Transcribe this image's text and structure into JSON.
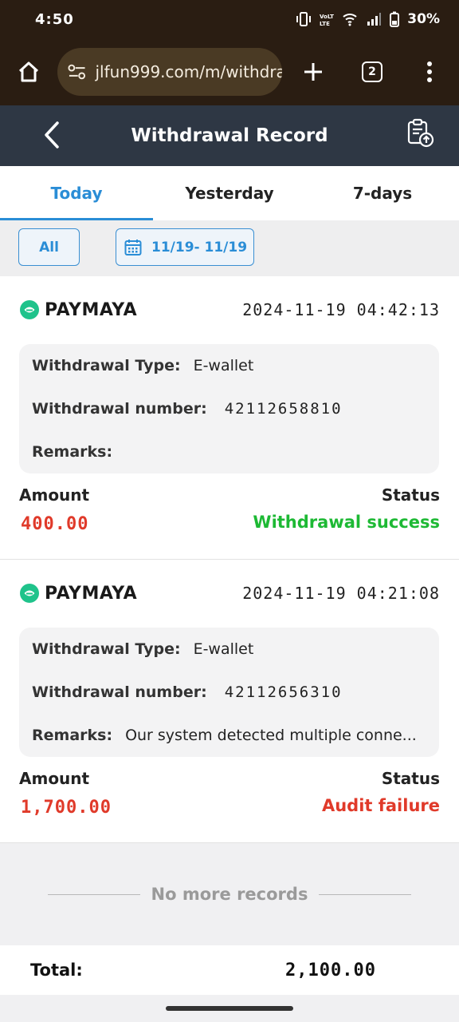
{
  "status_bar": {
    "time": "4:50",
    "battery": "30%"
  },
  "browser": {
    "url": "jlfun999.com/m/withdra",
    "tab_count": "2"
  },
  "header": {
    "title": "Withdrawal Record"
  },
  "tabs": [
    {
      "label": "Today",
      "active": true
    },
    {
      "label": "Yesterday",
      "active": false
    },
    {
      "label": "7-days",
      "active": false
    }
  ],
  "filter": {
    "all_label": "All",
    "date_range": "11/19- 11/19"
  },
  "records": [
    {
      "provider": "PAYMAYA",
      "time": "2024-11-19 04:42:13",
      "type_label": "Withdrawal Type:",
      "type_value": "E-wallet",
      "number_label": "Withdrawal number:",
      "number_value": "42112658810",
      "remarks_label": "Remarks:",
      "remarks_value": "",
      "amount_label": "Amount",
      "amount_value": "400.00",
      "status_label": "Status",
      "status_value": "Withdrawal success",
      "status_color": "#1db934"
    },
    {
      "provider": "PAYMAYA",
      "time": "2024-11-19 04:21:08",
      "type_label": "Withdrawal Type:",
      "type_value": "E-wallet",
      "number_label": "Withdrawal number:",
      "number_value": "42112656310",
      "remarks_label": "Remarks:",
      "remarks_value": "Our system detected multiple conne...",
      "amount_label": "Amount",
      "amount_value": "1,700.00",
      "status_label": "Status",
      "status_value": "Audit failure",
      "status_color": "#e03a2a"
    }
  ],
  "footer": {
    "no_more": "No more records"
  },
  "total": {
    "label": "Total:",
    "value": "2,100.00"
  },
  "colors": {
    "accent": "#2a8dd6",
    "header_bg": "#2e3744",
    "amount": "#e03a2a",
    "paymaya_green": "#1fc38b"
  }
}
